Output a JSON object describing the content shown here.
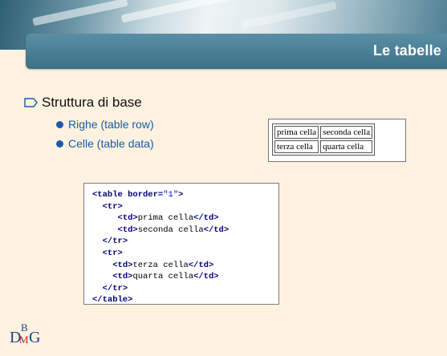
{
  "header": {
    "title": "Le tabelle"
  },
  "content": {
    "heading": "Struttura di base",
    "items": [
      {
        "label": "Righe (table row)"
      },
      {
        "label": "Celle (table data)"
      }
    ]
  },
  "example_table": {
    "rows": [
      [
        "prima cella",
        "seconda cella"
      ],
      [
        "terza cella",
        "quarta cella"
      ]
    ]
  },
  "code": {
    "lines": [
      {
        "tag1": "<table border=",
        "str": "\"1\"",
        "tag2": ">",
        "txt": "",
        "tag3": ""
      },
      {
        "tag1": "<tr>",
        "str": "",
        "tag2": "",
        "txt": "",
        "tag3": ""
      },
      {
        "tag1": "<td>",
        "str": "",
        "tag2": "",
        "txt": "prima cella",
        "tag3": "</td>"
      },
      {
        "tag1": "<td>",
        "str": "",
        "tag2": "",
        "txt": "seconda cella",
        "tag3": "</td>"
      },
      {
        "tag1": "</tr>",
        "str": "",
        "tag2": "",
        "txt": "",
        "tag3": ""
      },
      {
        "tag1": "<tr>",
        "str": "",
        "tag2": "",
        "txt": "",
        "tag3": ""
      },
      {
        "tag1": "<td>",
        "str": "",
        "tag2": "",
        "txt": "terza cella",
        "tag3": "</td>"
      },
      {
        "tag1": "<td>",
        "str": "",
        "tag2": "",
        "txt": "quarta cella",
        "tag3": "</td>"
      },
      {
        "tag1": "</tr>",
        "str": "",
        "tag2": "",
        "txt": "",
        "tag3": ""
      },
      {
        "tag1": "</table>",
        "str": "",
        "tag2": "",
        "txt": "",
        "tag3": ""
      }
    ]
  },
  "logo": {
    "d": "D",
    "b": "B",
    "m": "M",
    "g": "G"
  },
  "colors": {
    "accent": "#3d7188",
    "bullet": "#1b5aa8",
    "background": "#fdf2e0"
  }
}
